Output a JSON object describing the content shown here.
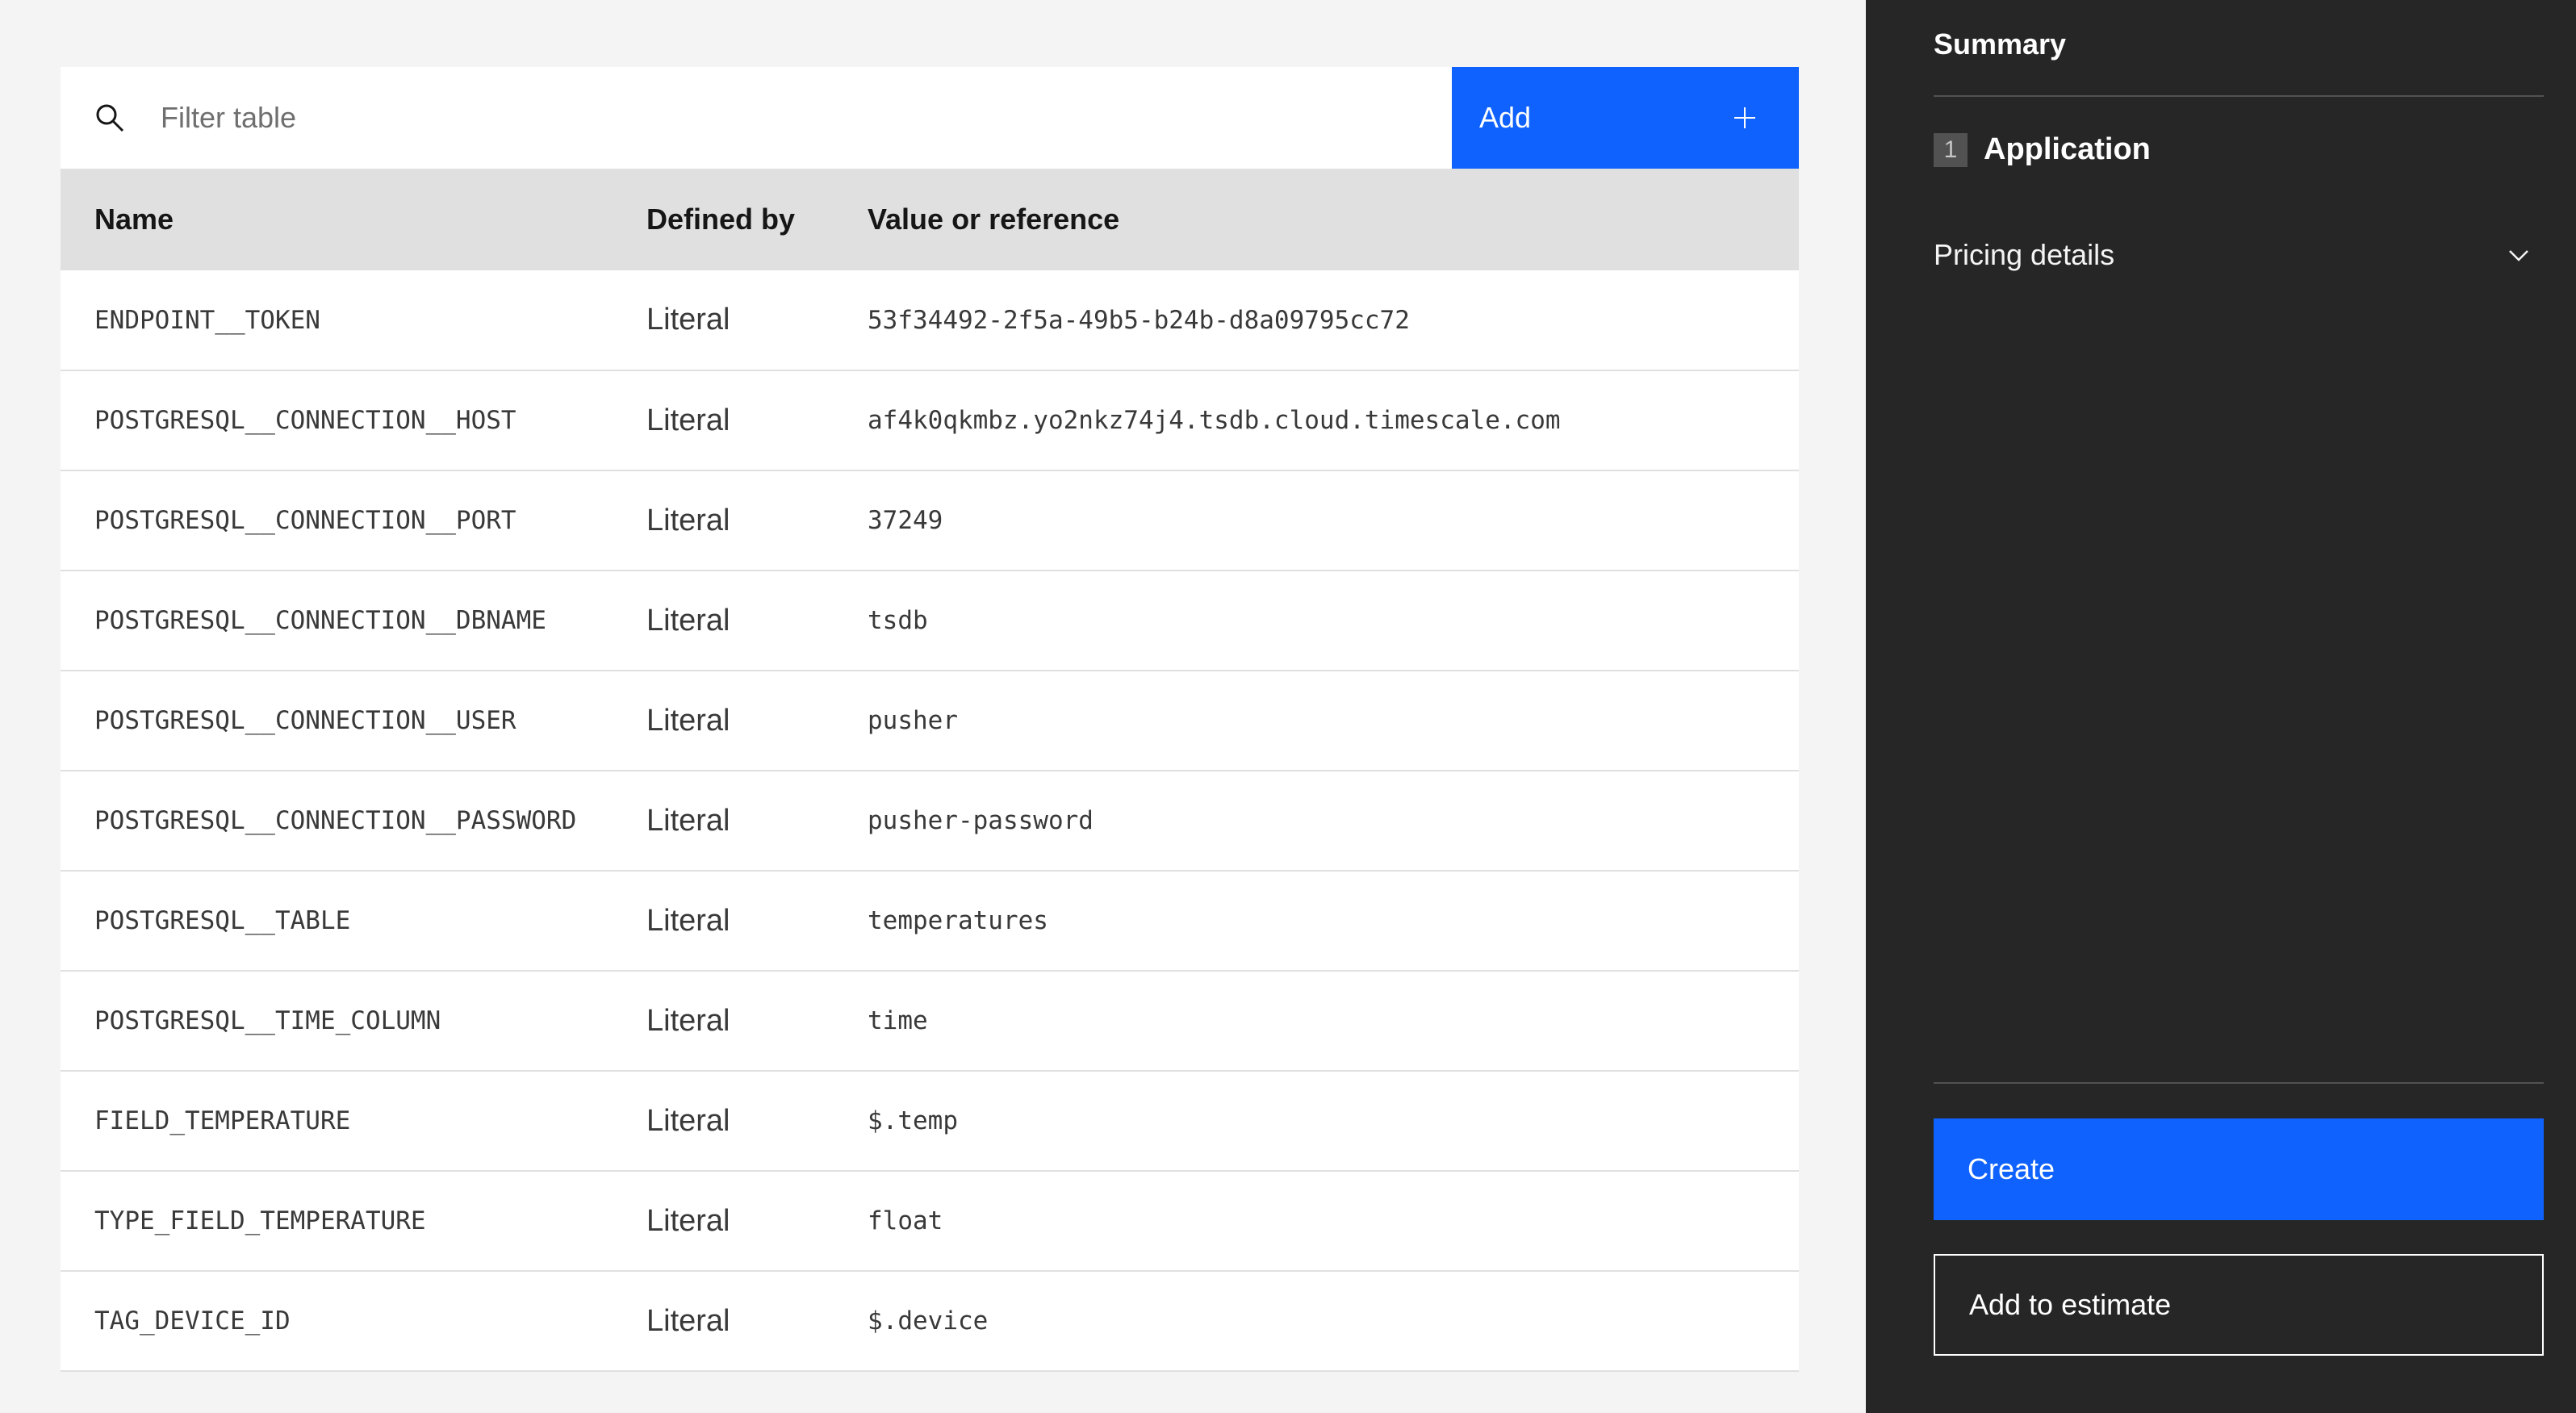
{
  "toolbar": {
    "search_placeholder": "Filter table",
    "add_label": "Add"
  },
  "table": {
    "headers": {
      "name": "Name",
      "defined_by": "Defined by",
      "value": "Value or reference"
    },
    "rows": [
      {
        "name": "ENDPOINT__TOKEN",
        "defined_by": "Literal",
        "value": "53f34492-2f5a-49b5-b24b-d8a09795cc72"
      },
      {
        "name": "POSTGRESQL__CONNECTION__HOST",
        "defined_by": "Literal",
        "value": "af4k0qkmbz.yo2nkz74j4.tsdb.cloud.timescale.com"
      },
      {
        "name": "POSTGRESQL__CONNECTION__PORT",
        "defined_by": "Literal",
        "value": "37249"
      },
      {
        "name": "POSTGRESQL__CONNECTION__DBNAME",
        "defined_by": "Literal",
        "value": "tsdb"
      },
      {
        "name": "POSTGRESQL__CONNECTION__USER",
        "defined_by": "Literal",
        "value": "pusher"
      },
      {
        "name": "POSTGRESQL__CONNECTION__PASSWORD",
        "defined_by": "Literal",
        "value": "pusher-password"
      },
      {
        "name": "POSTGRESQL__TABLE",
        "defined_by": "Literal",
        "value": "temperatures"
      },
      {
        "name": "POSTGRESQL__TIME_COLUMN",
        "defined_by": "Literal",
        "value": "time"
      },
      {
        "name": "FIELD_TEMPERATURE",
        "defined_by": "Literal",
        "value": "$.temp"
      },
      {
        "name": "TYPE_FIELD_TEMPERATURE",
        "defined_by": "Literal",
        "value": "float"
      },
      {
        "name": "TAG_DEVICE_ID",
        "defined_by": "Literal",
        "value": "$.device"
      }
    ]
  },
  "sidebar": {
    "title": "Summary",
    "step_number": "1",
    "step_label": "Application",
    "pricing_label": "Pricing details",
    "create_label": "Create",
    "estimate_label": "Add to estimate"
  },
  "colors": {
    "primary": "#0f62fe",
    "sidebar_bg": "#262626",
    "header_bg": "#e0e0e0",
    "page_bg": "#f4f4f4"
  },
  "icons": {
    "search": "search-icon",
    "add": "plus-icon",
    "pricing_toggle": "chevron-down-icon"
  }
}
